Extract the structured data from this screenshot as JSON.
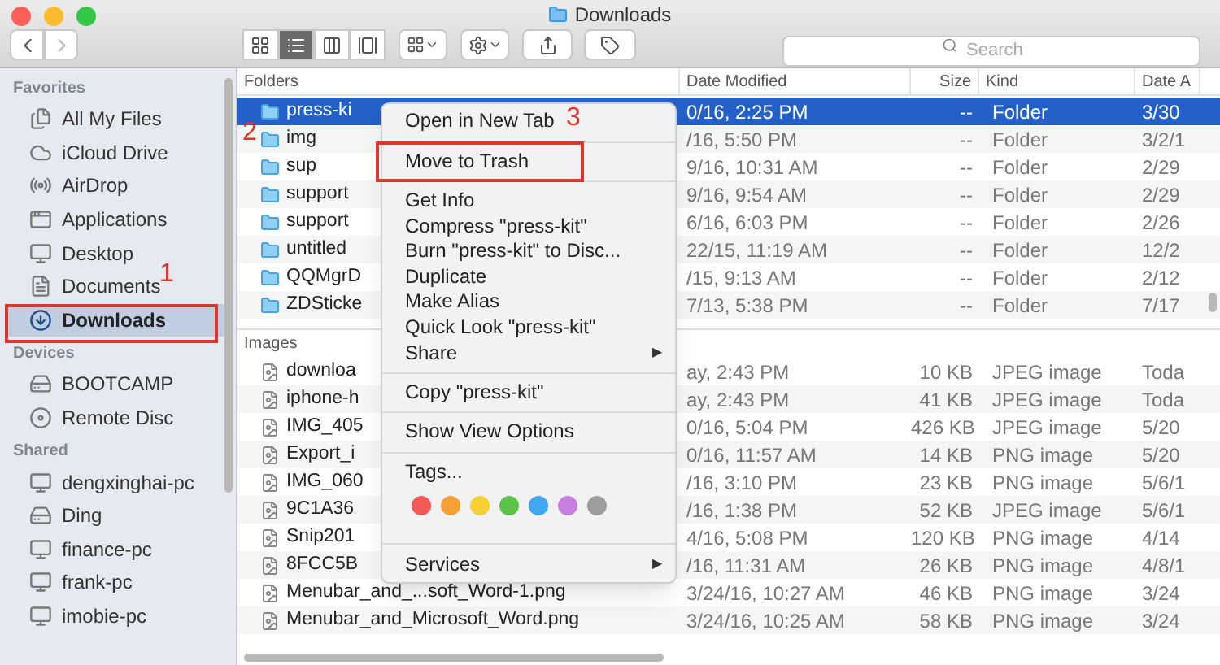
{
  "window": {
    "title": "Downloads"
  },
  "toolbar": {
    "view_modes": [
      {
        "selected": false
      },
      {
        "selected": true
      },
      {
        "selected": false
      },
      {
        "selected": false
      }
    ],
    "search": {
      "placeholder": "Search"
    }
  },
  "sidebar": {
    "sections": [
      {
        "heading": "Favorites",
        "items": [
          {
            "label": "All My Files",
            "selected": false
          },
          {
            "label": "iCloud Drive",
            "selected": false
          },
          {
            "label": "AirDrop",
            "selected": false
          },
          {
            "label": "Applications",
            "selected": false
          },
          {
            "label": "Desktop",
            "selected": false
          },
          {
            "label": "Documents",
            "selected": false
          },
          {
            "label": "Downloads",
            "selected": true
          }
        ]
      },
      {
        "heading": "Devices",
        "items": [
          {
            "label": "BOOTCAMP",
            "selected": false
          },
          {
            "label": "Remote Disc",
            "selected": false
          }
        ]
      },
      {
        "heading": "Shared",
        "items": [
          {
            "label": "dengxinghai-pc",
            "selected": false
          },
          {
            "label": "Ding",
            "selected": false
          },
          {
            "label": "finance-pc",
            "selected": false
          },
          {
            "label": "frank-pc",
            "selected": false
          },
          {
            "label": "imobie-pc",
            "selected": false
          }
        ]
      }
    ]
  },
  "table": {
    "columns": [
      "Folders",
      "Date Modified",
      "Size",
      "Kind",
      "Date A"
    ],
    "sections": [
      {
        "kind": "folder",
        "rows": [
          {
            "name": "press-ki",
            "date_modified": "0/16, 2:25 PM",
            "size": "--",
            "kind": "Folder",
            "date_added": "3/30",
            "selected": true
          },
          {
            "name": "img",
            "date_modified": "/16, 5:50 PM",
            "size": "--",
            "kind": "Folder",
            "date_added": "3/2/1",
            "selected": false
          },
          {
            "name": "sup",
            "date_modified": "9/16, 10:31 AM",
            "size": "--",
            "kind": "Folder",
            "date_added": "2/29",
            "selected": false
          },
          {
            "name": "support",
            "date_modified": "9/16, 9:54 AM",
            "size": "--",
            "kind": "Folder",
            "date_added": "2/29",
            "selected": false
          },
          {
            "name": "support",
            "date_modified": "6/16, 6:03 PM",
            "size": "--",
            "kind": "Folder",
            "date_added": "2/26",
            "selected": false
          },
          {
            "name": "untitled",
            "date_modified": "22/15, 11:19 AM",
            "size": "--",
            "kind": "Folder",
            "date_added": "12/2",
            "selected": false
          },
          {
            "name": "QQMgrD",
            "date_modified": "/15, 9:13 AM",
            "size": "--",
            "kind": "Folder",
            "date_added": "2/12",
            "selected": false
          },
          {
            "name": "ZDSticke",
            "date_modified": "7/13, 5:38 PM",
            "size": "--",
            "kind": "Folder",
            "date_added": "7/17",
            "selected": false
          }
        ]
      },
      {
        "heading": "Images",
        "kind": "image",
        "rows": [
          {
            "name": "downloa",
            "date_modified": "ay, 2:43 PM",
            "size": "10 KB",
            "kind": "JPEG image",
            "date_added": "Toda",
            "selected": false
          },
          {
            "name": "iphone-h",
            "date_modified": "ay, 2:43 PM",
            "size": "41 KB",
            "kind": "JPEG image",
            "date_added": "Toda",
            "selected": false
          },
          {
            "name": "IMG_405",
            "date_modified": "0/16, 5:04 PM",
            "size": "426 KB",
            "kind": "JPEG image",
            "date_added": "5/20",
            "selected": false
          },
          {
            "name": "Export_i",
            "date_modified": "0/16, 11:57 AM",
            "size": "14 KB",
            "kind": "PNG image",
            "date_added": "5/20",
            "selected": false
          },
          {
            "name": "IMG_060",
            "date_modified": "/16, 3:10 PM",
            "size": "23 KB",
            "kind": "PNG image",
            "date_added": "5/6/1",
            "selected": false
          },
          {
            "name": "9C1A36",
            "date_modified": "/16, 1:38 PM",
            "size": "52 KB",
            "kind": "JPEG image",
            "date_added": "5/6/1",
            "selected": false
          },
          {
            "name": "Snip201",
            "date_modified": "4/16, 5:08 PM",
            "size": "120 KB",
            "kind": "PNG image",
            "date_added": "4/14",
            "selected": false
          },
          {
            "name": "8FCC5B",
            "date_modified": "/16, 11:31 AM",
            "size": "26 KB",
            "kind": "PNG image",
            "date_added": "4/8/1",
            "selected": false
          },
          {
            "name": "Menubar_and_...soft_Word-1.png",
            "date_modified": "3/24/16, 10:27 AM",
            "size": "46 KB",
            "kind": "PNG image",
            "date_added": "3/24",
            "selected": false
          },
          {
            "name": "Menubar_and_Microsoft_Word.png",
            "date_modified": "3/24/16, 10:25 AM",
            "size": "58 KB",
            "kind": "PNG image",
            "date_added": "3/24",
            "selected": false
          }
        ]
      }
    ]
  },
  "context_menu": {
    "groups": [
      [
        {
          "label": "Open in New Tab",
          "kind": "item"
        }
      ],
      [
        {
          "label": "Move to Trash",
          "kind": "item"
        }
      ],
      [
        {
          "label": "Get Info",
          "kind": "item"
        },
        {
          "label": "Compress \"press-kit\"",
          "kind": "item"
        },
        {
          "label": "Burn \"press-kit\" to Disc...",
          "kind": "item"
        },
        {
          "label": "Duplicate",
          "kind": "item"
        },
        {
          "label": "Make Alias",
          "kind": "item"
        },
        {
          "label": "Quick Look \"press-kit\"",
          "kind": "item"
        },
        {
          "label": "Share",
          "kind": "submenu",
          "arrow": "▶"
        }
      ],
      [
        {
          "label": "Copy \"press-kit\"",
          "kind": "item"
        }
      ],
      [
        {
          "label": "Show View Options",
          "kind": "item"
        }
      ],
      [
        {
          "label": "Tags...",
          "kind": "item"
        },
        {
          "kind": "tags",
          "tags": [
            {
              "color": "#f25a57"
            },
            {
              "color": "#f5a033"
            },
            {
              "color": "#f5cf34"
            },
            {
              "color": "#5ac449"
            },
            {
              "color": "#3fa8f0"
            },
            {
              "color": "#c77ee0"
            },
            {
              "color": "#9d9d9d"
            }
          ]
        }
      ],
      [
        {
          "label": "Services",
          "kind": "submenu",
          "arrow": "▶"
        }
      ]
    ]
  },
  "annotations": [
    {
      "label": "1"
    },
    {
      "label": "2"
    },
    {
      "label": "3"
    }
  ]
}
